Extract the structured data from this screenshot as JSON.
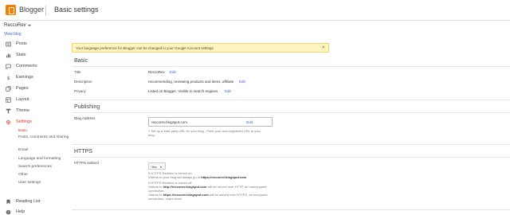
{
  "topbar": {
    "app_name": "Blogger",
    "page_title": "Basic settings"
  },
  "sidebar": {
    "blog_name": "ReccoRev",
    "view_blog": "View blog",
    "items": [
      {
        "label": "Posts",
        "icon": "posts-icon"
      },
      {
        "label": "Stats",
        "icon": "stats-icon"
      },
      {
        "label": "Comments",
        "icon": "comments-icon"
      },
      {
        "label": "Earnings",
        "icon": "earnings-icon"
      },
      {
        "label": "Pages",
        "icon": "pages-icon"
      },
      {
        "label": "Layout",
        "icon": "layout-icon"
      },
      {
        "label": "Theme",
        "icon": "theme-icon"
      },
      {
        "label": "Settings",
        "icon": "gear-icon"
      }
    ],
    "settings_subitems": [
      "Basic",
      "Posts, comments and sharing",
      "Email",
      "Language and formatting",
      "Search preferences",
      "Other",
      "User settings"
    ],
    "reading_list": "Reading List",
    "help": "Help"
  },
  "banner": {
    "text": "Your language preference for Blogger can be changed in your Google Account settings",
    "close": "✕"
  },
  "basic": {
    "heading": "Basic",
    "title_label": "Title",
    "title_value": "ReccoRev",
    "description_label": "Description",
    "description_value": "recommending, reviewing products and items, affiliate",
    "privacy_label": "Privacy",
    "privacy_value": "Listed on Blogger. Visible to search engines",
    "edit": "Edit"
  },
  "publishing": {
    "heading": "Publishing",
    "address_label": "Blog Address",
    "address_value": "reccorev.blogspot.com",
    "address_edit": "Edit",
    "help_line1": "+ Set up a third-party URL for your blog - Point your own registered URL to your",
    "help_line2": "blog."
  },
  "https": {
    "heading": "HTTPS",
    "redirect_label": "HTTPS redirect",
    "redirect_value": "Yes",
    "note1_line1": "If HTTPS Redirect is turned on:",
    "note1_line2_prefix": "Visitors to your blog will always go to ",
    "note1_line2_link": "https://reccorev.blogspot.com",
    "note2_line1": "If HTTPS Redirect is turned off:",
    "note2_line2_prefix": "Visitors to ",
    "note2_line2_link": "http://reccorev.blogspot.com",
    "note2_line2_suffix": " will be served over HTTP, an unencrypted",
    "note2_line3": "connection.",
    "note2_line4_prefix": "Visitors to ",
    "note2_line4_link": "https://reccorev.blogspot.com",
    "note2_line4_suffix": " will be served over HTTPS, an encrypted",
    "note2_line5": "connection. Learn more"
  },
  "colors": {
    "accent": "#f57d00",
    "active": "#d9372b",
    "link": "#3367d6",
    "banner_bg": "#fef3c3"
  }
}
